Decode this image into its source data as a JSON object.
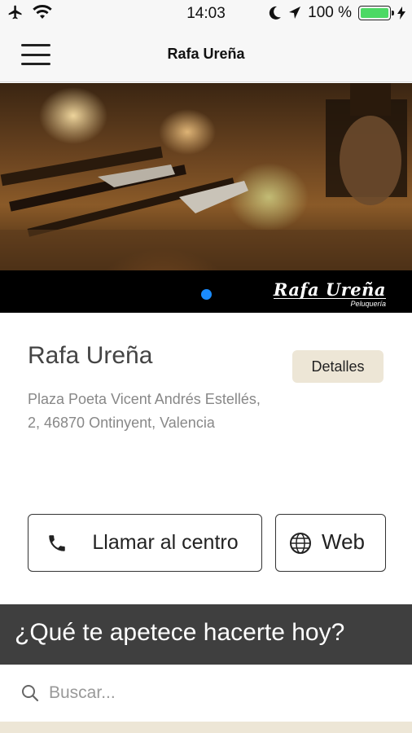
{
  "status": {
    "time": "14:03",
    "battery": "100 %",
    "battery_level": 1.0,
    "battery_color": "#4cd964"
  },
  "nav": {
    "title": "Rafa Ureña",
    "menu_icon": "hamburger-icon"
  },
  "hero": {
    "logo_main": "Rafa Ureña",
    "logo_sub": "Peluquería",
    "active_dot_color": "#1a8cff"
  },
  "shop": {
    "name": "Rafa Ureña",
    "details_label": "Detalles",
    "address": "Plaza Poeta Vicent Andrés Estellés, 2, 46870 Ontinyent, Valencia"
  },
  "actions": {
    "call_label": "Llamar al centro",
    "call_icon": "phone-icon",
    "web_label": "Web",
    "web_icon": "globe-icon"
  },
  "question": {
    "text": "¿Qué te apetece hacerte hoy?"
  },
  "search": {
    "placeholder": "Buscar...",
    "value": ""
  },
  "colors": {
    "accent_beige": "#ede6d6",
    "dark_bar": "#3f3f3f"
  }
}
